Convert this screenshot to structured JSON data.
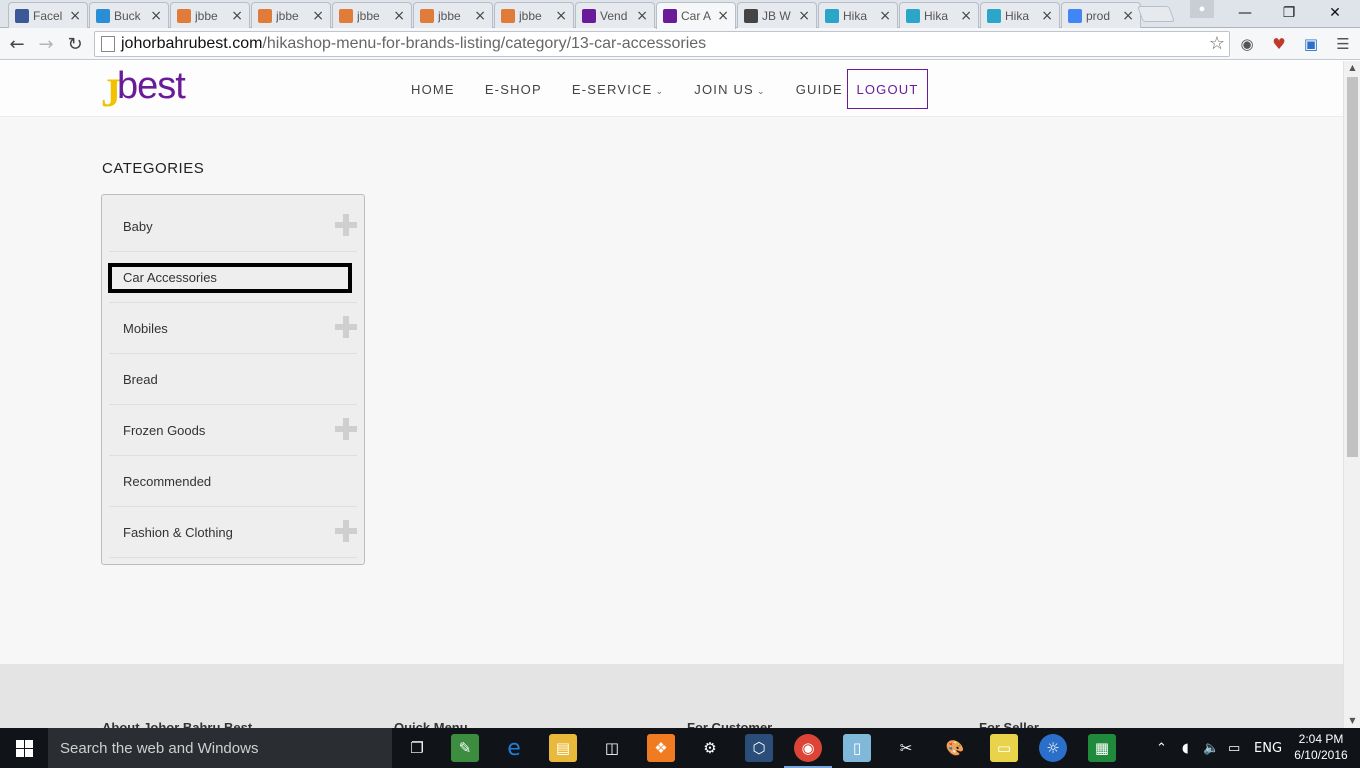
{
  "browser": {
    "tabs": [
      {
        "title": "Facel",
        "color": "#3b5998"
      },
      {
        "title": "Buck",
        "color": "#2a8ed6"
      },
      {
        "title": "jbbe",
        "color": "#e07b39"
      },
      {
        "title": "jbbe",
        "color": "#e07b39"
      },
      {
        "title": "jbbe",
        "color": "#e07b39"
      },
      {
        "title": "jbbe",
        "color": "#e07b39"
      },
      {
        "title": "jbbe",
        "color": "#e07b39"
      },
      {
        "title": "Vend",
        "color": "#6a1b9a"
      },
      {
        "title": "Car A",
        "color": "#6a1b9a",
        "active": true
      },
      {
        "title": "JB W",
        "color": "#444444"
      },
      {
        "title": "Hika",
        "color": "#2ba6c9"
      },
      {
        "title": "Hika",
        "color": "#2ba6c9"
      },
      {
        "title": "Hika",
        "color": "#2ba6c9"
      },
      {
        "title": "prod",
        "color": "#4285f4"
      }
    ],
    "tab_close": "×",
    "url_host": "johorbahrubest.com",
    "url_path": "/hikashop-menu-for-brands-listing/category/13-car-accessories"
  },
  "site": {
    "logo_j": "J",
    "logo_rest": "best",
    "nav": [
      {
        "label": "HOME"
      },
      {
        "label": "E-SHOP"
      },
      {
        "label": "E-SERVICE",
        "dropdown": true
      },
      {
        "label": "JOIN US",
        "dropdown": true
      },
      {
        "label": "GUIDE"
      }
    ],
    "logout": "LOGOUT",
    "categories_title": "CATEGORIES",
    "categories": [
      {
        "label": "Baby",
        "expandable": true
      },
      {
        "label": "Car Accessories",
        "expandable": false,
        "selected": true
      },
      {
        "label": "Mobiles",
        "expandable": true
      },
      {
        "label": "Bread",
        "expandable": false
      },
      {
        "label": "Frozen Goods",
        "expandable": true
      },
      {
        "label": "Recommended",
        "expandable": false
      },
      {
        "label": "Fashion & Clothing",
        "expandable": true
      }
    ],
    "footer_headings": [
      "About Johor Bahru Best",
      "Quick Menu",
      "For Customer",
      "For Seller"
    ]
  },
  "taskbar": {
    "search_placeholder": "Search the web and Windows",
    "language": "ENG",
    "time": "2:04 PM",
    "date": "6/10/2016"
  },
  "colors": {
    "brand_purple": "#6a1b9a",
    "brand_yellow": "#f2c200"
  }
}
